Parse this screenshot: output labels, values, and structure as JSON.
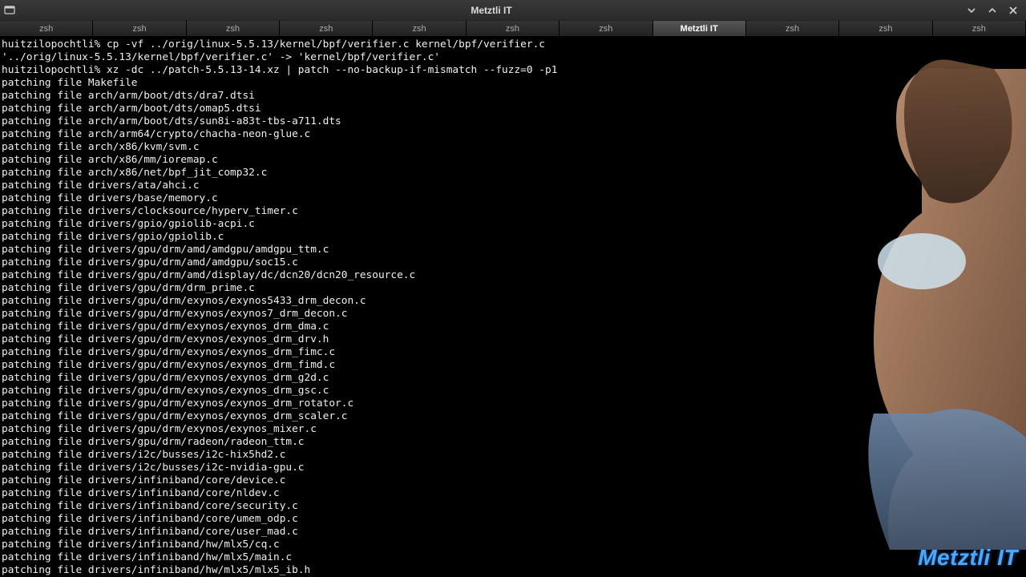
{
  "window": {
    "title": "Metztli IT"
  },
  "tabs": [
    {
      "label": "zsh",
      "active": false
    },
    {
      "label": "zsh",
      "active": false
    },
    {
      "label": "zsh",
      "active": false
    },
    {
      "label": "zsh",
      "active": false
    },
    {
      "label": "zsh",
      "active": false
    },
    {
      "label": "zsh",
      "active": false
    },
    {
      "label": "zsh",
      "active": false
    },
    {
      "label": "Metztli IT",
      "active": true
    },
    {
      "label": "zsh",
      "active": false
    },
    {
      "label": "zsh",
      "active": false
    },
    {
      "label": "zsh",
      "active": false
    }
  ],
  "terminal": {
    "prompt_host": "huitzilopochtli",
    "lines": [
      "huitzilopochtli% cp -vf ../orig/linux-5.5.13/kernel/bpf/verifier.c kernel/bpf/verifier.c",
      "'../orig/linux-5.5.13/kernel/bpf/verifier.c' -> 'kernel/bpf/verifier.c'",
      "huitzilopochtli% xz -dc ../patch-5.5.13-14.xz | patch --no-backup-if-mismatch --fuzz=0 -p1",
      "patching file Makefile",
      "patching file arch/arm/boot/dts/dra7.dtsi",
      "patching file arch/arm/boot/dts/omap5.dtsi",
      "patching file arch/arm/boot/dts/sun8i-a83t-tbs-a711.dts",
      "patching file arch/arm64/crypto/chacha-neon-glue.c",
      "patching file arch/x86/kvm/svm.c",
      "patching file arch/x86/mm/ioremap.c",
      "patching file arch/x86/net/bpf_jit_comp32.c",
      "patching file drivers/ata/ahci.c",
      "patching file drivers/base/memory.c",
      "patching file drivers/clocksource/hyperv_timer.c",
      "patching file drivers/gpio/gpiolib-acpi.c",
      "patching file drivers/gpio/gpiolib.c",
      "patching file drivers/gpu/drm/amd/amdgpu/amdgpu_ttm.c",
      "patching file drivers/gpu/drm/amd/amdgpu/soc15.c",
      "patching file drivers/gpu/drm/amd/display/dc/dcn20/dcn20_resource.c",
      "patching file drivers/gpu/drm/drm_prime.c",
      "patching file drivers/gpu/drm/exynos/exynos5433_drm_decon.c",
      "patching file drivers/gpu/drm/exynos/exynos7_drm_decon.c",
      "patching file drivers/gpu/drm/exynos/exynos_drm_dma.c",
      "patching file drivers/gpu/drm/exynos/exynos_drm_drv.h",
      "patching file drivers/gpu/drm/exynos/exynos_drm_fimc.c",
      "patching file drivers/gpu/drm/exynos/exynos_drm_fimd.c",
      "patching file drivers/gpu/drm/exynos/exynos_drm_g2d.c",
      "patching file drivers/gpu/drm/exynos/exynos_drm_gsc.c",
      "patching file drivers/gpu/drm/exynos/exynos_drm_rotator.c",
      "patching file drivers/gpu/drm/exynos/exynos_drm_scaler.c",
      "patching file drivers/gpu/drm/exynos/exynos_mixer.c",
      "patching file drivers/gpu/drm/radeon/radeon_ttm.c",
      "patching file drivers/i2c/busses/i2c-hix5hd2.c",
      "patching file drivers/i2c/busses/i2c-nvidia-gpu.c",
      "patching file drivers/infiniband/core/device.c",
      "patching file drivers/infiniband/core/nldev.c",
      "patching file drivers/infiniband/core/security.c",
      "patching file drivers/infiniband/core/umem_odp.c",
      "patching file drivers/infiniband/core/user_mad.c",
      "patching file drivers/infiniband/hw/mlx5/cq.c",
      "patching file drivers/infiniband/hw/mlx5/main.c",
      "patching file drivers/infiniband/hw/mlx5/mlx5_ib.h"
    ]
  },
  "watermark": "Metztli IT"
}
